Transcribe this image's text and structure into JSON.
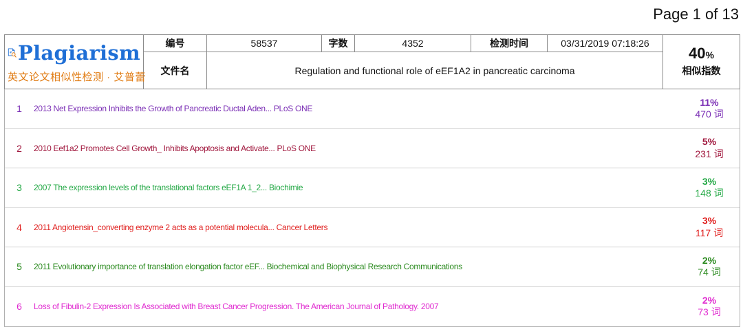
{
  "page_indicator": "Page 1 of 13",
  "logo": {
    "title": "Plagiarism",
    "subtitle": "英文论文相似性检测 · 艾普蕾",
    "icon": "document-magnifier-icon"
  },
  "meta": {
    "id_label": "编号",
    "id_value": "58537",
    "wordcount_label": "字数",
    "wordcount_value": "4352",
    "time_label": "检测时间",
    "time_value": "03/31/2019 07:18:26",
    "filename_label": "文件名",
    "filename_value": "Regulation and functional role of eEF1A2 in pancreatic carcinoma"
  },
  "similarity": {
    "percent": "40",
    "unit": "%",
    "label": "相似指数"
  },
  "results": [
    {
      "index": "1",
      "title": "2013 Net Expression Inhibits the Growth of Pancreatic Ductal Aden... PLoS ONE",
      "percent": "11%",
      "words": "470 词",
      "color": "#7b2fb5"
    },
    {
      "index": "2",
      "title": "2010 Eef1a2 Promotes Cell Growth_ Inhibits Apoptosis and Activate... PLoS ONE",
      "percent": "5%",
      "words": "231 词",
      "color": "#a0163c"
    },
    {
      "index": "3",
      "title": "2007 The expression levels of the translational factors eEF1A 1_2... Biochimie",
      "percent": "3%",
      "words": "148 词",
      "color": "#23a845"
    },
    {
      "index": "4",
      "title": "2011 Angiotensin_converting enzyme 2 acts as a potential molecula... Cancer Letters",
      "percent": "3%",
      "words": "117 词",
      "color": "#e0201f"
    },
    {
      "index": "5",
      "title": "2011 Evolutionary importance of translation elongation factor eEF... Biochemical and Biophysical Research Communications",
      "percent": "2%",
      "words": "74 词",
      "color": "#2a8a1e"
    },
    {
      "index": "6",
      "title": "Loss of Fibulin-2 Expression Is Associated with Breast Cancer Progression. The American Journal of Pathology. 2007",
      "percent": "2%",
      "words": "73 词",
      "color": "#e02bd0"
    }
  ]
}
